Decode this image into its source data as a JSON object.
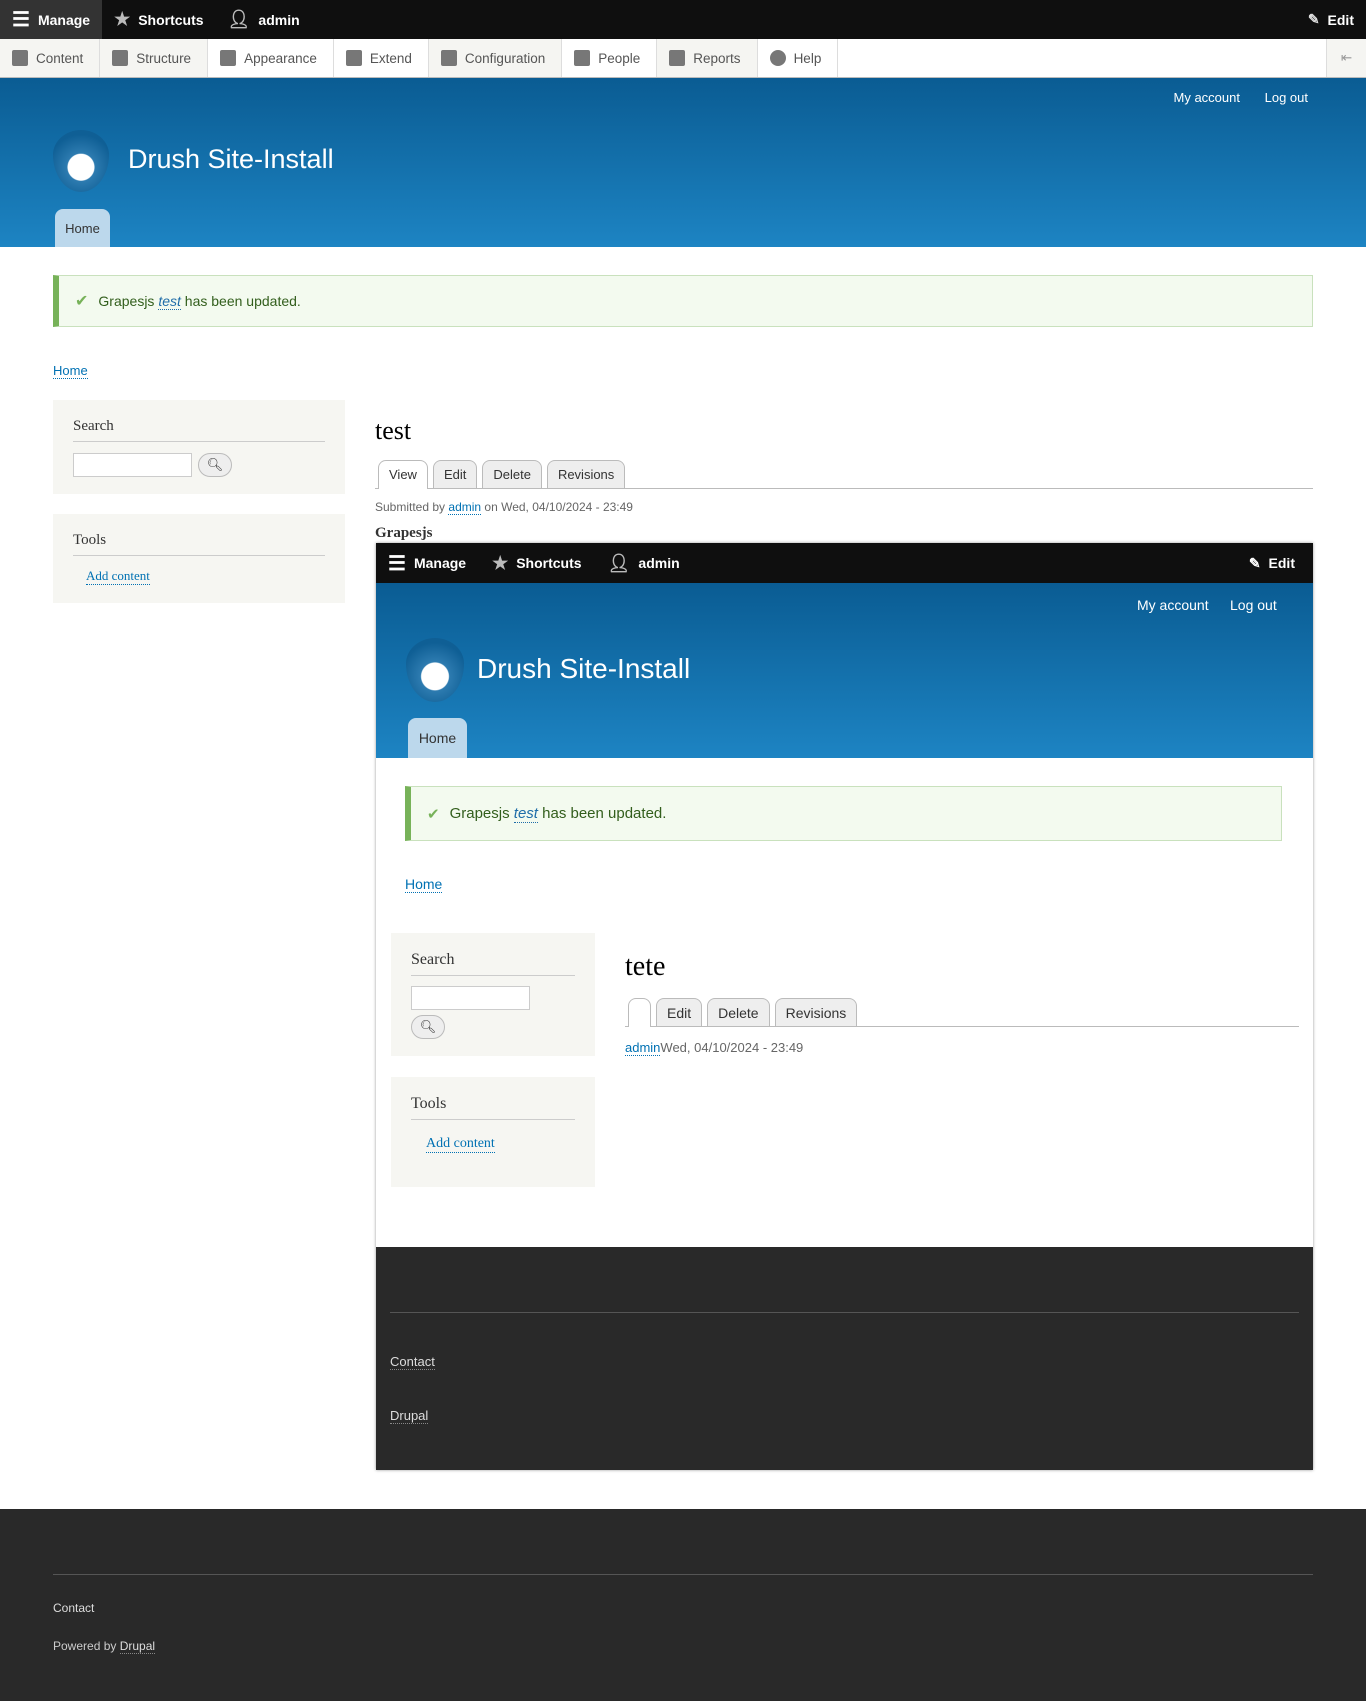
{
  "toolbar": {
    "manage": "Manage",
    "shortcuts": "Shortcuts",
    "user": "admin",
    "edit": "Edit"
  },
  "tray": [
    "Content",
    "Structure",
    "Appearance",
    "Extend",
    "Configuration",
    "People",
    "Reports",
    "Help"
  ],
  "header": {
    "my_account": "My account",
    "log_out": "Log out",
    "site_name": "Drush Site-Install",
    "home_tab": "Home"
  },
  "message": {
    "prefix": "Grapesjs",
    "link": "test",
    "suffix": "has been updated."
  },
  "breadcrumb": "Home",
  "sidebar": {
    "search_title": "Search",
    "tools_title": "Tools",
    "add_content": "Add content"
  },
  "node": {
    "title": "test",
    "tabs": [
      "View",
      "Edit",
      "Delete",
      "Revisions"
    ],
    "submitted_prefix": "Submitted by",
    "author": "admin",
    "submitted_suffix": "on Wed, 04/10/2024 - 23:49",
    "field_label": "Grapesjs"
  },
  "embedded": {
    "title": "tete",
    "tabs": [
      "",
      "Edit",
      "Delete",
      "Revisions"
    ],
    "author": "admin",
    "date": "Wed, 04/10/2024 - 23:49",
    "footer_links": [
      "Contact",
      "Drupal"
    ]
  },
  "footer": {
    "contact": "Contact",
    "powered": "Powered by",
    "drupal": "Drupal"
  }
}
